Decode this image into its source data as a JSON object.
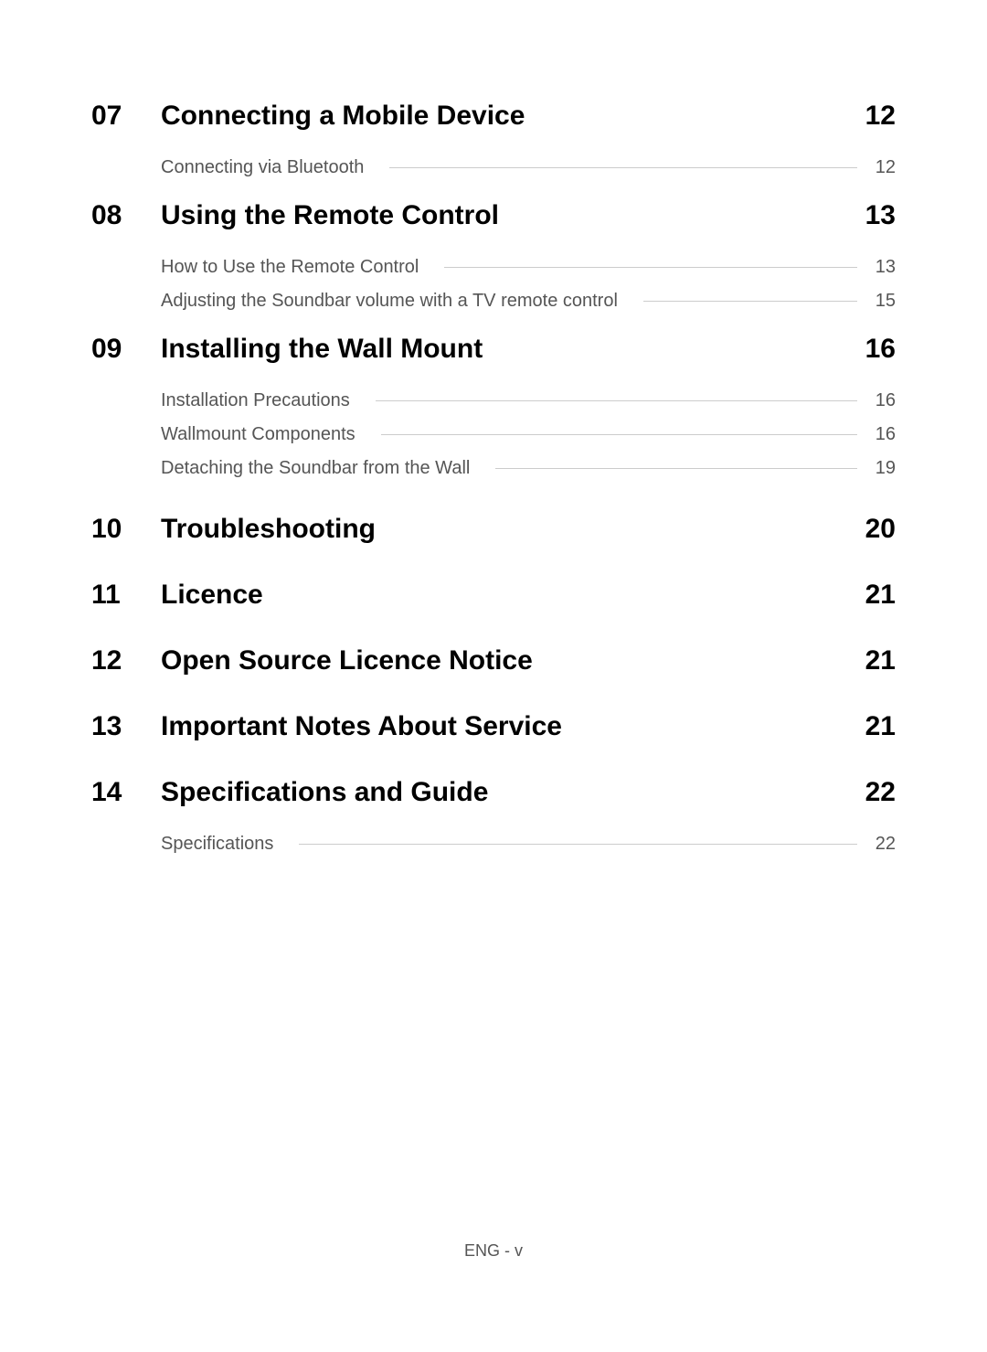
{
  "toc": [
    {
      "number": "07",
      "title": "Connecting a Mobile Device",
      "page": "12",
      "items": [
        {
          "label": "Connecting via Bluetooth",
          "page": "12"
        }
      ]
    },
    {
      "number": "08",
      "title": "Using the Remote Control",
      "page": "13",
      "items": [
        {
          "label": "How to Use the Remote Control",
          "page": "13"
        },
        {
          "label": "Adjusting the Soundbar volume with a TV remote control",
          "page": "15"
        }
      ]
    },
    {
      "number": "09",
      "title": "Installing the Wall Mount",
      "page": "16",
      "items": [
        {
          "label": "Installation Precautions",
          "page": "16"
        },
        {
          "label": "Wallmount Components",
          "page": "16"
        },
        {
          "label": "Detaching the Soundbar from the Wall",
          "page": "19"
        }
      ]
    },
    {
      "number": "10",
      "title": "Troubleshooting",
      "page": "20",
      "items": []
    },
    {
      "number": "11",
      "title": "Licence",
      "page": "21",
      "items": []
    },
    {
      "number": "12",
      "title": "Open Source Licence Notice",
      "page": "21",
      "items": []
    },
    {
      "number": "13",
      "title": "Important Notes About Service",
      "page": "21",
      "items": []
    },
    {
      "number": "14",
      "title": "Specifications and Guide",
      "page": "22",
      "items": [
        {
          "label": "Specifications",
          "page": "22"
        }
      ]
    }
  ],
  "footer": "ENG - v"
}
